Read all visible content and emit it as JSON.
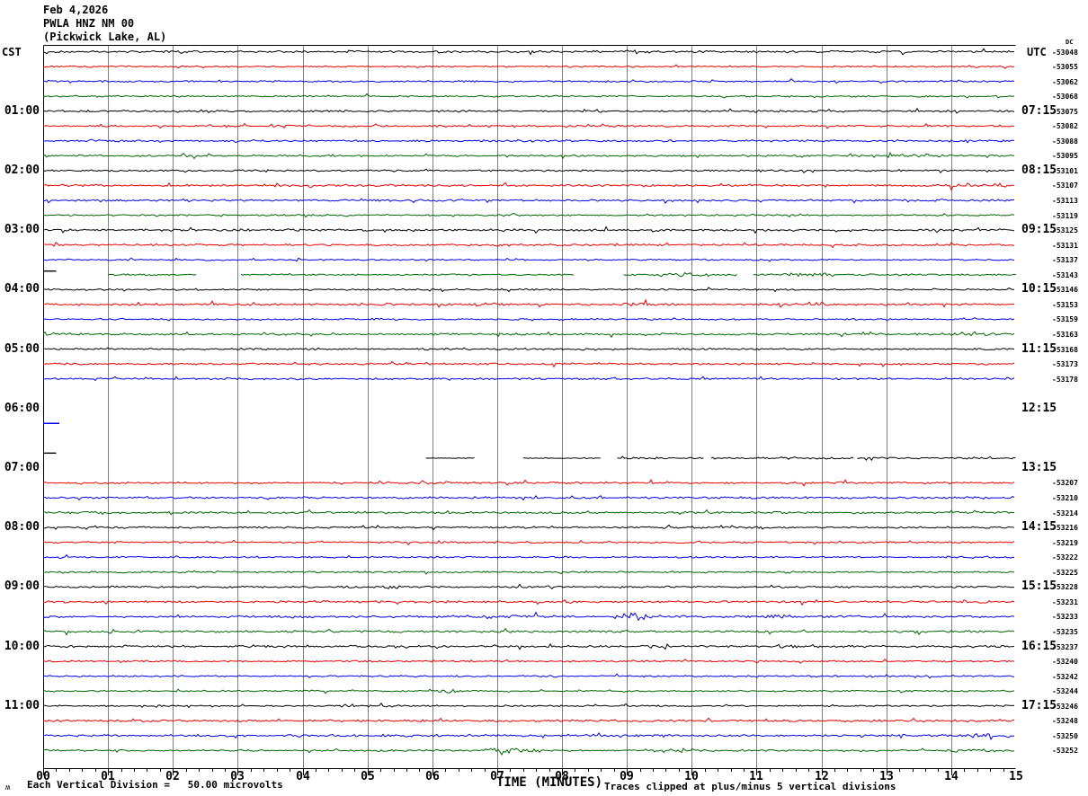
{
  "header": {
    "date": "Feb 4,2026",
    "station": "PWLA HNZ NM 00",
    "location": "(Pickwick Lake, AL)",
    "left_tz": "CST",
    "right_tz": "UTC",
    "dc_caption": "DC"
  },
  "axis": {
    "xlabel": "TIME (MINUTES)",
    "x_ticks": [
      "00",
      "01",
      "02",
      "03",
      "04",
      "05",
      "06",
      "07",
      "08",
      "09",
      "10",
      "11",
      "12",
      "13",
      "14",
      "15"
    ],
    "minor_ticks_per_minute": 5
  },
  "footer": {
    "scale_note": "Each Vertical Division =   50.00 microvolts",
    "clip_note": "Traces clipped at plus/minus 5 vertical divisions",
    "corner_mark": "ʍ"
  },
  "left_hour_labels": [
    "01:00",
    "02:00",
    "03:00",
    "04:00",
    "05:00",
    "06:00",
    "07:00",
    "08:00",
    "09:00",
    "10:00",
    "11:00"
  ],
  "right_hour_labels": [
    "07:15",
    "08:15",
    "09:15",
    "10:15",
    "11:15",
    "12:15",
    "13:15",
    "14:15",
    "15:15",
    "16:15",
    "17:15"
  ],
  "colors": {
    "bg": "#ffffff",
    "grid": "#808080",
    "border": "#000000",
    "trace_map": {
      "black": "#000000",
      "red": "#ee0000",
      "blue": "#0000ee",
      "green": "#006600"
    }
  },
  "chart_data": {
    "type": "line",
    "kind": "helicorder-seismogram",
    "minutes_per_line": 15,
    "x_range_minutes": [
      0,
      15
    ],
    "vertical_division_microvolts": 50.0,
    "clip_divisions": 5,
    "rows": [
      {
        "start_cst": "00:00",
        "color": "black",
        "dc": -53048,
        "status": "normal"
      },
      {
        "start_cst": "00:15",
        "color": "red",
        "dc": -53055,
        "status": "normal"
      },
      {
        "start_cst": "00:30",
        "color": "blue",
        "dc": -53062,
        "status": "normal"
      },
      {
        "start_cst": "00:45",
        "color": "green",
        "dc": -53068,
        "status": "normal"
      },
      {
        "start_cst": "01:00",
        "color": "black",
        "dc": -53075,
        "status": "normal"
      },
      {
        "start_cst": "01:15",
        "color": "red",
        "dc": -53082,
        "status": "normal"
      },
      {
        "start_cst": "01:30",
        "color": "blue",
        "dc": -53088,
        "status": "normal"
      },
      {
        "start_cst": "01:45",
        "color": "green",
        "dc": -53095,
        "status": "normal",
        "bursts": [
          [
            13.0,
            13.9,
            2.0
          ]
        ]
      },
      {
        "start_cst": "02:00",
        "color": "black",
        "dc": -53101,
        "status": "normal"
      },
      {
        "start_cst": "02:15",
        "color": "red",
        "dc": -53107,
        "status": "normal",
        "bursts": [
          [
            14.0,
            15.0,
            2.0
          ]
        ]
      },
      {
        "start_cst": "02:30",
        "color": "blue",
        "dc": -53113,
        "status": "normal"
      },
      {
        "start_cst": "02:45",
        "color": "green",
        "dc": -53119,
        "status": "normal"
      },
      {
        "start_cst": "03:00",
        "color": "black",
        "dc": -53125,
        "status": "normal"
      },
      {
        "start_cst": "03:15",
        "color": "red",
        "dc": -53131,
        "status": "normal"
      },
      {
        "start_cst": "03:30",
        "color": "blue",
        "dc": -53137,
        "status": "normal"
      },
      {
        "start_cst": "03:45",
        "color": "green",
        "dc": -53143,
        "status": "partial",
        "segments": [
          [
            1.0,
            2.36
          ],
          [
            3.05,
            8.2
          ],
          [
            8.95,
            10.7
          ],
          [
            10.95,
            15.0
          ]
        ],
        "bursts": [
          [
            9.5,
            10.4,
            2.5
          ],
          [
            11.4,
            12.2,
            2.2
          ]
        ]
      },
      {
        "start_cst": "04:00",
        "color": "black",
        "dc": -53146,
        "status": "normal"
      },
      {
        "start_cst": "04:15",
        "color": "red",
        "dc": -53153,
        "status": "normal",
        "bursts": [
          [
            8.9,
            9.3,
            2.2
          ]
        ]
      },
      {
        "start_cst": "04:30",
        "color": "blue",
        "dc": -53159,
        "status": "normal"
      },
      {
        "start_cst": "04:45",
        "color": "green",
        "dc": -53163,
        "status": "normal"
      },
      {
        "start_cst": "05:00",
        "color": "black",
        "dc": -53168,
        "status": "normal"
      },
      {
        "start_cst": "05:15",
        "color": "red",
        "dc": -53173,
        "status": "normal"
      },
      {
        "start_cst": "05:30",
        "color": "blue",
        "dc": -53178,
        "status": "normal"
      },
      {
        "start_cst": "05:45",
        "color": "green",
        "dc": null,
        "status": "blank"
      },
      {
        "start_cst": "06:00",
        "color": "black",
        "dc": null,
        "status": "blank"
      },
      {
        "start_cst": "06:15",
        "color": "red",
        "dc": null,
        "status": "blank"
      },
      {
        "start_cst": "06:30",
        "color": "blue",
        "dc": null,
        "status": "blank"
      },
      {
        "start_cst": "06:45",
        "color": "green",
        "dc": null,
        "status": "blank"
      },
      {
        "start_cst": "07:00",
        "color": "black",
        "dc": null,
        "status": "partial",
        "dy": -11,
        "amp": 0.55,
        "segments": [
          [
            5.9,
            6.65
          ],
          [
            7.4,
            8.6
          ],
          [
            8.85,
            10.2
          ],
          [
            10.3,
            12.5
          ],
          [
            12.55,
            15.0
          ]
        ],
        "bursts": [
          [
            8.9,
            15.0,
            2.2
          ]
        ]
      },
      {
        "start_cst": "07:15",
        "color": "red",
        "dc": -53207,
        "status": "normal"
      },
      {
        "start_cst": "07:30",
        "color": "blue",
        "dc": -53210,
        "status": "normal"
      },
      {
        "start_cst": "07:45",
        "color": "green",
        "dc": -53214,
        "status": "normal"
      },
      {
        "start_cst": "08:00",
        "color": "black",
        "dc": -53216,
        "status": "normal"
      },
      {
        "start_cst": "08:15",
        "color": "red",
        "dc": -53219,
        "status": "normal"
      },
      {
        "start_cst": "08:30",
        "color": "blue",
        "dc": -53222,
        "status": "normal"
      },
      {
        "start_cst": "08:45",
        "color": "green",
        "dc": -53225,
        "status": "normal"
      },
      {
        "start_cst": "09:00",
        "color": "black",
        "dc": -53228,
        "status": "normal",
        "bursts": [
          [
            5.2,
            5.6,
            2.0
          ]
        ]
      },
      {
        "start_cst": "09:15",
        "color": "red",
        "dc": -53231,
        "status": "normal"
      },
      {
        "start_cst": "09:30",
        "color": "blue",
        "dc": -53233,
        "status": "normal",
        "bursts": [
          [
            6.3,
            7.6,
            1.8
          ],
          [
            8.8,
            9.4,
            3.2
          ],
          [
            11.0,
            11.6,
            1.8
          ]
        ]
      },
      {
        "start_cst": "09:45",
        "color": "green",
        "dc": -53235,
        "status": "normal"
      },
      {
        "start_cst": "10:00",
        "color": "black",
        "dc": -53237,
        "status": "normal",
        "bursts": [
          [
            11.3,
            11.7,
            2.0
          ]
        ]
      },
      {
        "start_cst": "10:15",
        "color": "red",
        "dc": -53240,
        "status": "normal"
      },
      {
        "start_cst": "10:30",
        "color": "blue",
        "dc": -53242,
        "status": "normal"
      },
      {
        "start_cst": "10:45",
        "color": "green",
        "dc": -53244,
        "status": "normal",
        "bursts": [
          [
            6.0,
            6.4,
            2.0
          ]
        ]
      },
      {
        "start_cst": "11:00",
        "color": "black",
        "dc": -53246,
        "status": "normal",
        "bursts": [
          [
            5.0,
            5.6,
            1.6
          ]
        ]
      },
      {
        "start_cst": "11:15",
        "color": "red",
        "dc": -53248,
        "status": "normal"
      },
      {
        "start_cst": "11:30",
        "color": "blue",
        "dc": -53250,
        "status": "normal",
        "bursts": [
          [
            14.3,
            15.0,
            1.8
          ]
        ]
      },
      {
        "start_cst": "11:45",
        "color": "green",
        "dc": -53252,
        "status": "normal",
        "bursts": [
          [
            6.8,
            7.7,
            2.6
          ],
          [
            13.9,
            14.7,
            1.8
          ]
        ]
      }
    ],
    "gap_dashes": [
      {
        "line": 15,
        "color": "black",
        "from": 0.0,
        "to": 0.2,
        "dy": -4
      },
      {
        "line": 25,
        "color": "blue",
        "from": 0.0,
        "to": 0.25,
        "dy": 0
      },
      {
        "line": 27,
        "color": "black",
        "from": 0.0,
        "to": 0.2,
        "dy": 0
      }
    ]
  }
}
